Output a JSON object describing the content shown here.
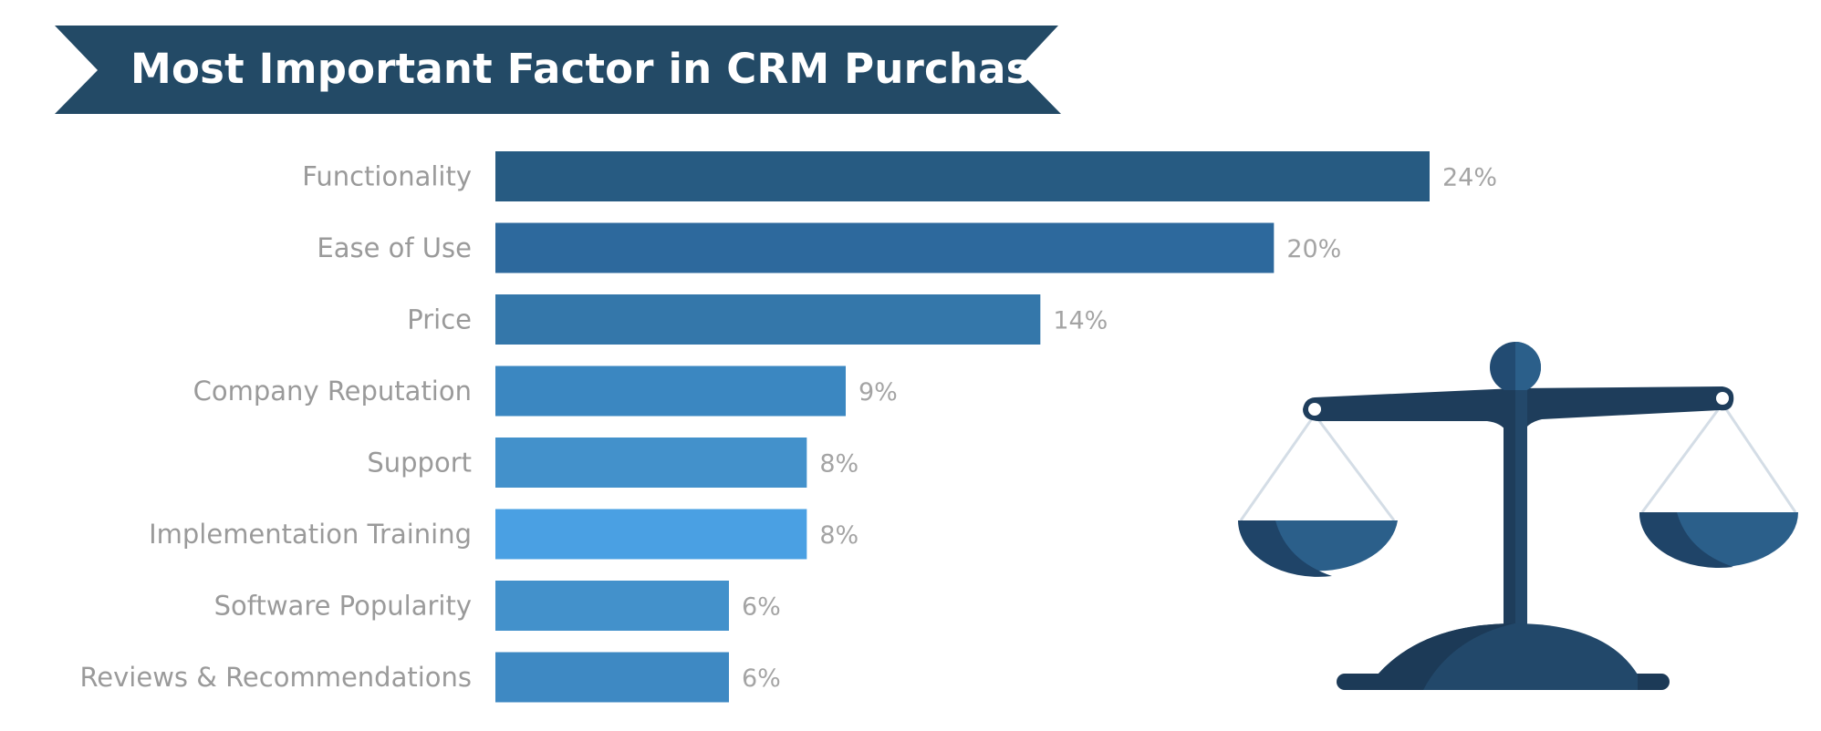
{
  "title": "Most Important Factor in CRM Purchase",
  "colors": {
    "banner": "#234a66",
    "label_text": "#9a9a9a",
    "value_text": "#a4a4a4",
    "scale_dark": "#1c3a57",
    "scale_mid": "#22486a",
    "scale_light": "#2b5f8a",
    "scale_strings": "#d4dde6"
  },
  "icon": {
    "name": "balance-scale-icon"
  },
  "chart_data": {
    "type": "bar",
    "orientation": "horizontal",
    "title": "Most Important Factor in CRM Purchase",
    "xlabel": "",
    "ylabel": "",
    "grid": false,
    "legend": "none",
    "value_format": "{v}%",
    "xlim": [
      0,
      24
    ],
    "categories": [
      "Functionality",
      "Ease of Use",
      "Price",
      "Company Reputation",
      "Support",
      "Implementation Training",
      "Software Popularity",
      "Reviews & Recommendations"
    ],
    "values": [
      24,
      20,
      14,
      9,
      8,
      8,
      6,
      6
    ],
    "value_labels": [
      "24%",
      "20%",
      "14%",
      "9%",
      "8%",
      "8%",
      "6%",
      "6%"
    ],
    "bar_colors": [
      "#275b82",
      "#2d699d",
      "#3477aa",
      "#3b87c1",
      "#4391cb",
      "#4aa0e3",
      "#4391cb",
      "#3e89c3"
    ]
  }
}
